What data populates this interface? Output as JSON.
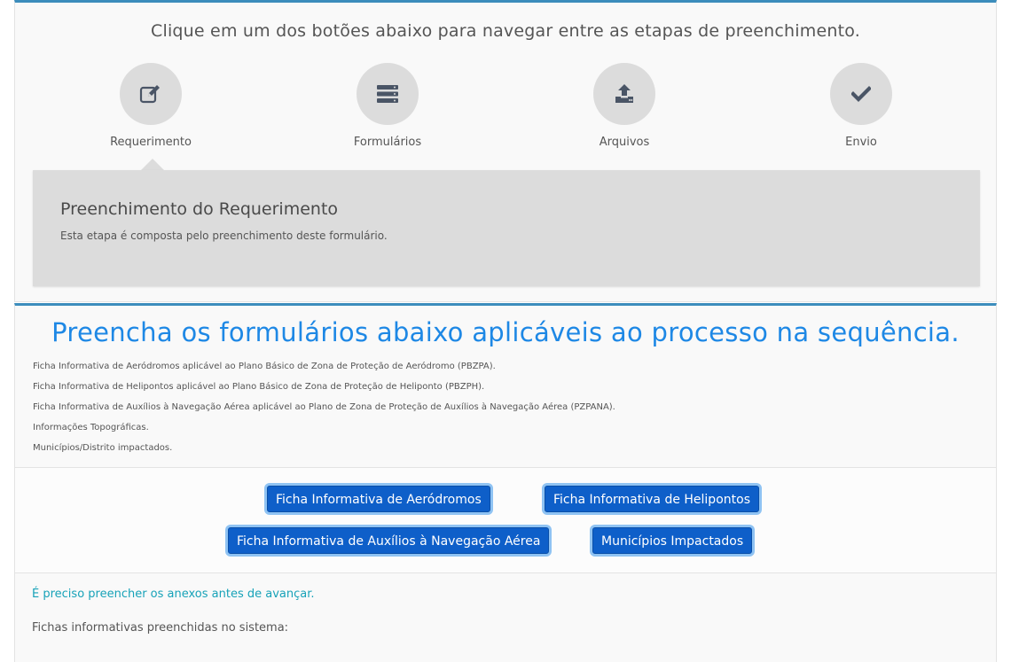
{
  "steps": {
    "title": "Clique em um dos botões abaixo para navegar entre as etapas de preenchimento.",
    "items": [
      {
        "label": "Requerimento",
        "icon": "edit-icon"
      },
      {
        "label": "Formulários",
        "icon": "server-icon"
      },
      {
        "label": "Arquivos",
        "icon": "upload-icon"
      },
      {
        "label": "Envio",
        "icon": "check-icon"
      }
    ],
    "active": 0,
    "info": {
      "title": "Preenchimento do Requerimento",
      "description": "Esta etapa é composta pelo preenchimento deste formulário."
    }
  },
  "forms": {
    "title": "Preencha os formulários abaixo aplicáveis ao processo na sequência.",
    "items": [
      "Ficha Informativa de Aeródromos aplicável ao Plano Básico de Zona de Proteção de Aeródromo (PBZPA).",
      "Ficha Informativa de Helipontos aplicável ao Plano Básico de Zona de Proteção de Heliponto (PBZPH).",
      "Ficha Informativa de Auxílios à Navegação Aérea aplicável ao Plano de Zona de Proteção de Auxílios à Navegação Aérea (PZPANA).",
      "Informações Topográficas.",
      "Municípios/Distrito impactados."
    ],
    "buttons": {
      "aerodromos": "Ficha Informativa de Aeródromos",
      "helipontos": "Ficha Informativa de Helipontos",
      "auxilios": "Ficha Informativa de Auxílios à Navegação Aérea",
      "municipios": "Municípios Impactados"
    },
    "warning": "É preciso preencher os anexos antes de avançar.",
    "fichas_label": "Fichas informativas preenchidas no sistema:"
  },
  "colors": {
    "accent": "#3c8dbc",
    "title_blue": "#1e88e5",
    "button_blue": "#0e5fc9",
    "warning_teal": "#17a2b8",
    "step_circle": "#dcdcdc"
  }
}
